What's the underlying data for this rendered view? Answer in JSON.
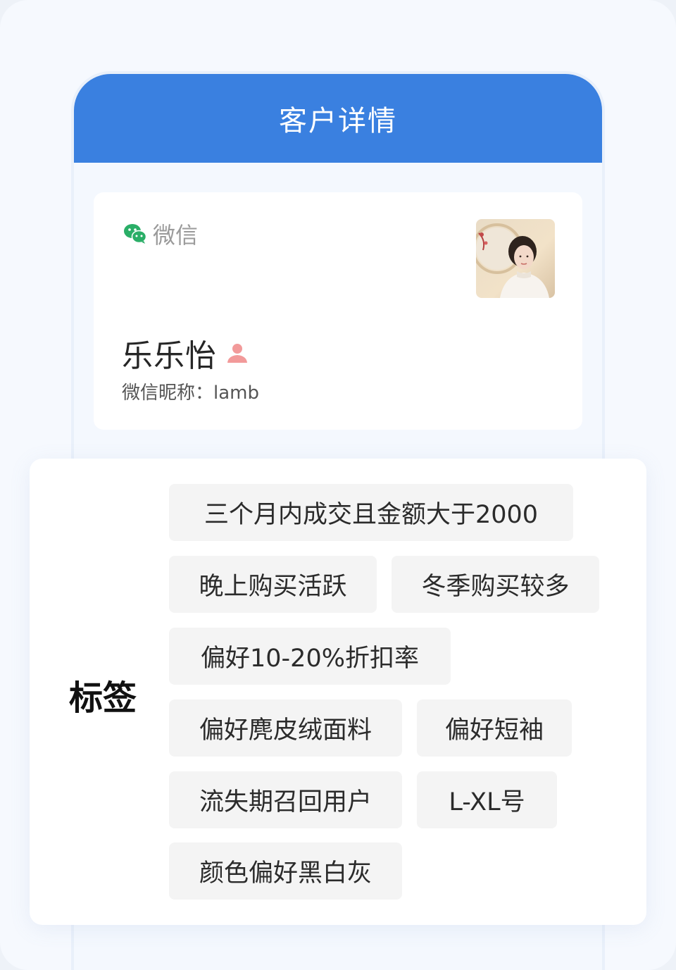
{
  "header": {
    "title": "客户详情"
  },
  "profile": {
    "source_label": "微信",
    "source_icon": "wechat-icon",
    "name": "乐乐怡",
    "gender_icon": "female-user-icon",
    "nickname_text": "微信昵称：lamb",
    "avatar": "customer-photo"
  },
  "tags": {
    "label": "标签",
    "items": [
      "三个月内成交且金额大于2000",
      "晚上购买活跃",
      "冬季购买较多",
      "偏好10-20%折扣率",
      "偏好麂皮绒面料",
      "偏好短袖",
      "流失期召回用户",
      "L-XL号",
      "颜色偏好黑白灰"
    ]
  },
  "colors": {
    "header_bg": "#3a80e0",
    "wechat_green": "#2aae67",
    "gender_pink": "#f29a9a",
    "tag_bg": "#f4f4f4"
  }
}
